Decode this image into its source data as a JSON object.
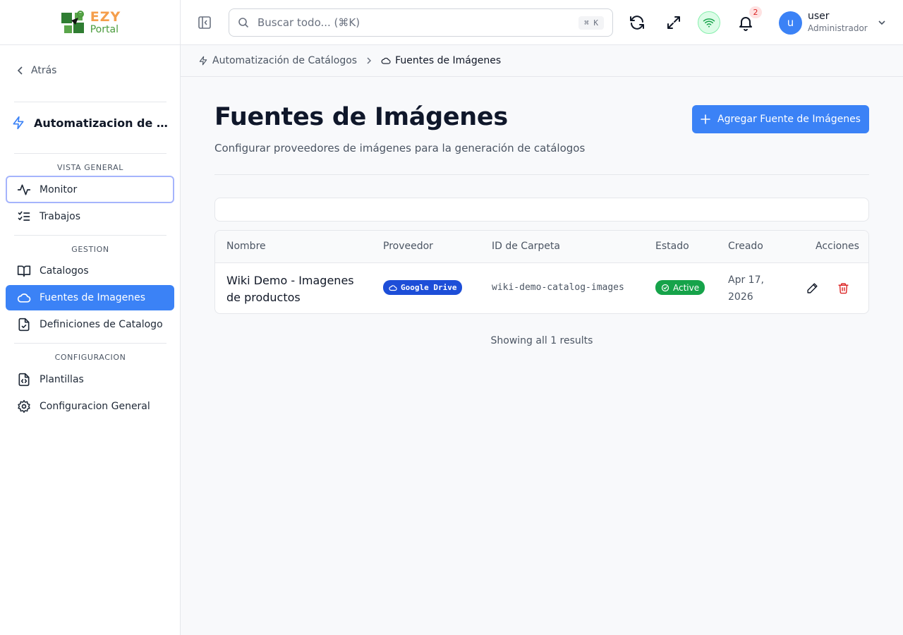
{
  "sidebar": {
    "logo": {
      "line1": "EZY",
      "line2": "Portal"
    },
    "back_label": "Atrás",
    "module_title": "Automatizacion de Catalogos",
    "sections": {
      "overview": "VISTA GENERAL",
      "management": "GESTION",
      "config": "CONFIGURACION"
    },
    "items": {
      "monitor": "Monitor",
      "jobs": "Trabajos",
      "catalogs": "Catalogos",
      "image_sources": "Fuentes de Imagenes",
      "catalog_definitions": "Definiciones de Catalogo",
      "templates": "Plantillas",
      "general_settings": "Configuracion General"
    }
  },
  "header": {
    "search_placeholder": "Buscar todo... (⌘K)",
    "search_shortcut": "⌘ K",
    "notification_count": "2",
    "user": {
      "initial": "u",
      "name": "user",
      "role": "Administrador"
    }
  },
  "breadcrumb": {
    "parent": "Automatización de Catálogos",
    "current": "Fuentes de Imágenes"
  },
  "page": {
    "title": "Fuentes de Imágenes",
    "subtitle": "Configurar proveedores de imágenes para la generación de catálogos",
    "add_button": "Agregar Fuente de Imágenes"
  },
  "table": {
    "columns": {
      "name": "Nombre",
      "provider": "Proveedor",
      "folder_id": "ID de Carpeta",
      "status": "Estado",
      "created": "Creado",
      "actions": "Acciones"
    },
    "rows": [
      {
        "name": "Wiki Demo - Imagenes de productos",
        "provider": "Google Drive",
        "folder_id": "wiki-demo-catalog-images",
        "status": "Active",
        "created": "Apr 17, 2026"
      }
    ],
    "results_text": "Showing all 1 results"
  },
  "colors": {
    "accent": "#3b82f6",
    "provider_badge": "#1d4ed8",
    "status_active": "#16a34a",
    "delete": "#dc2626"
  }
}
